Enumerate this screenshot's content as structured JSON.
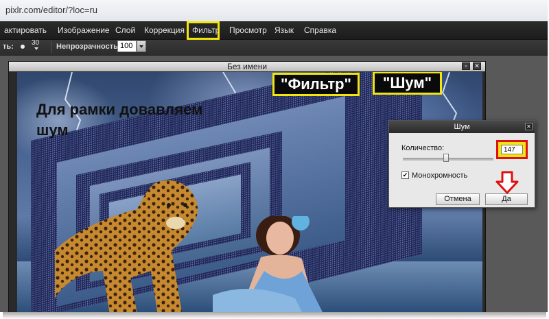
{
  "browser": {
    "url": "pixlr.com/editor/?loc=ru"
  },
  "menu": [
    {
      "label": "актировать"
    },
    {
      "label": "Изображение"
    },
    {
      "label": "Слой"
    },
    {
      "label": "Коррекция"
    },
    {
      "label": "Фильтр"
    },
    {
      "label": "Просмотр"
    },
    {
      "label": "Язык"
    },
    {
      "label": "Справка"
    }
  ],
  "options": {
    "brush_label": "ть:",
    "brush_size": "30",
    "opacity_label": "Непрозрачность:",
    "opacity_value": "100"
  },
  "document": {
    "title": "Без имени",
    "headline_line1": "Для рамки довавляем",
    "headline_line2": "шум",
    "label_filter": "\"Фильтр\"",
    "label_noise": "\"Шум\""
  },
  "dialog": {
    "title": "Шум",
    "amount_label": "Количество:",
    "amount_value": "147",
    "amount_slider": 0.48,
    "mono_label": "Монохромность",
    "mono_checked": true,
    "cancel": "Отмена",
    "ok": "Да"
  },
  "colors": {
    "highlight_yellow": "#f2e60c",
    "arrow_red": "#e01010"
  }
}
